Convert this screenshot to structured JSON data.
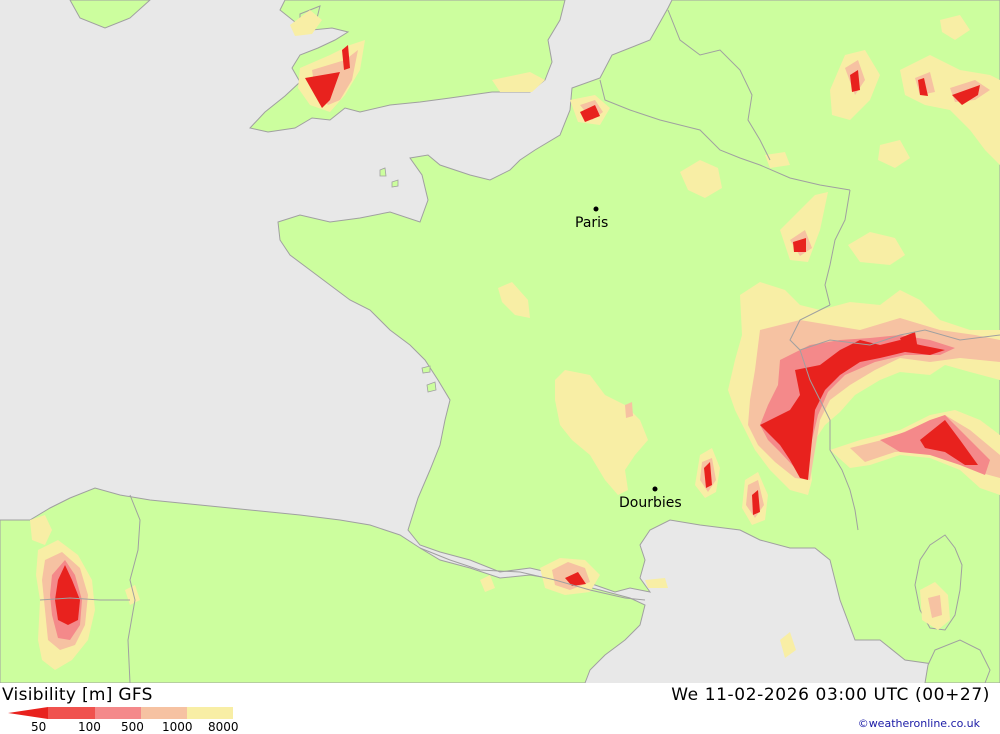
{
  "header": {
    "product_label": "Visibility [m] GFS",
    "valid_time": "We 11-02-2026 03:00 UTC (00+27)"
  },
  "legend": {
    "ticks": [
      "50",
      "100",
      "500",
      "1000",
      "8000"
    ],
    "colors": [
      "#e8221e",
      "#f0524e",
      "#f4898a",
      "#f6c2a2",
      "#f8eea5"
    ]
  },
  "map": {
    "colors": {
      "sea": "#e8e8e8",
      "land": "#ccfe9e",
      "visibility_8000": "#f8eea5",
      "visibility_1000": "#f6c2a2",
      "visibility_500": "#f4898a",
      "visibility_100": "#f0524e",
      "visibility_50": "#e8221e",
      "border": "#a0a0a0"
    },
    "cities": [
      {
        "name": "Paris"
      },
      {
        "name": "Dourbies"
      }
    ]
  },
  "credit": "©weatheronline.co.uk"
}
